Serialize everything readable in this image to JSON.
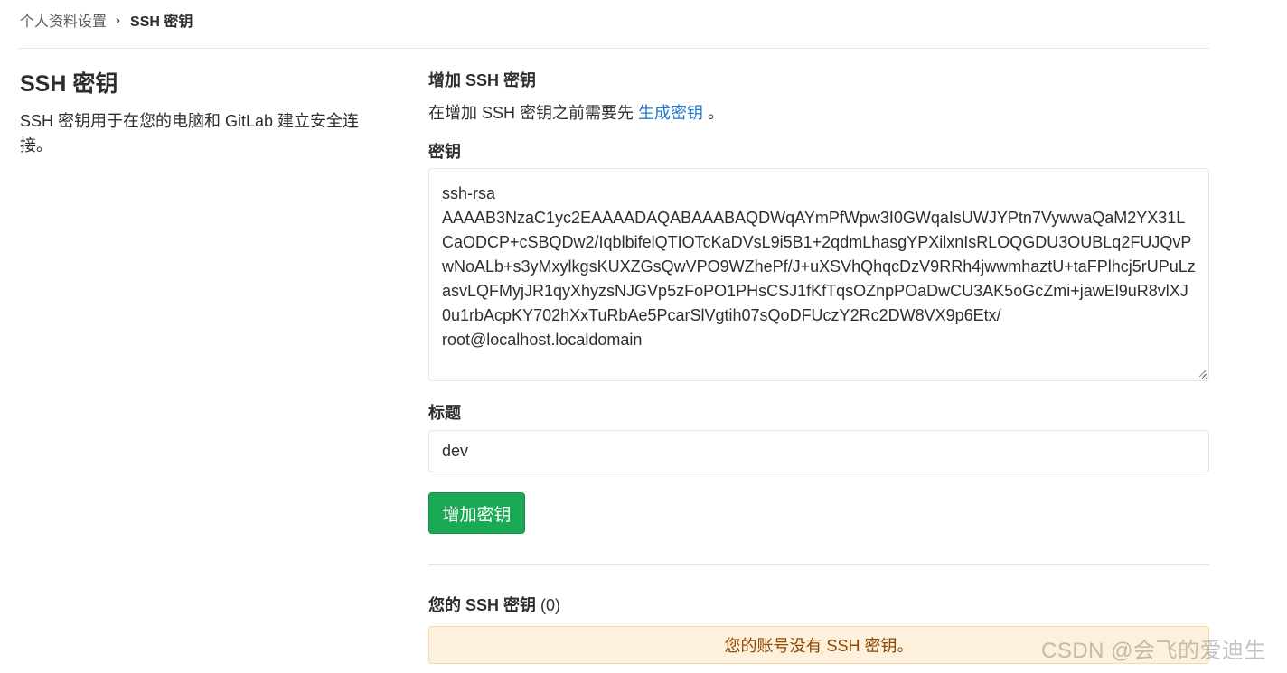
{
  "breadcrumb": {
    "parent": "个人资料设置",
    "separator": "›",
    "current": "SSH 密钥"
  },
  "left": {
    "title": "SSH 密钥",
    "description": "SSH 密钥用于在您的电脑和 GitLab 建立安全连接。"
  },
  "add_section": {
    "title": "增加 SSH 密钥",
    "intro_prefix": "在增加 SSH 密钥之前需要先 ",
    "intro_link": "生成密钥",
    "intro_suffix": " 。",
    "key_label": "密钥",
    "key_value": "ssh-rsa\nAAAAB3NzaC1yc2EAAAADAQABAAABAQDWqAYmPfWpw3I0GWqaIsUWJYPtn7VywwaQaM2YX31LCaODCP+cSBQDw2/IqblbifelQTIOTcKaDVsL9i5B1+2qdmLhasgYPXilxnIsRLOQGDU3OUBLq2FUJQvPwNoALb+s3yMxylkgsKUXZGsQwVPO9WZhePf/J+uXSVhQhqcDzV9RRh4jwwmhaztU+taFPlhcj5rUPuLzasvLQFMyjJR1qyXhyzsNJGVp5zFoPO1PHsCSJ1fKfTqsOZnpPOaDwCU3AK5oGcZmi+jawEl9uR8vlXJ0u1rbAcpKY702hXxTuRbAe5PcarSlVgtih07sQoDFUczY2Rc2DW8VX9p6Etx/\nroot@localhost.localdomain",
    "title_label": "标题",
    "title_value": "dev",
    "submit_label": "增加密钥"
  },
  "keys_list": {
    "heading": "您的 SSH 密钥",
    "count": "(0)",
    "empty_message": "您的账号没有 SSH 密钥。"
  },
  "watermark": "CSDN @会飞的爱迪生",
  "colors": {
    "primary_button": "#1aaa55",
    "link": "#1f78d1",
    "warning_bg": "#fdf1dd",
    "warning_text": "#8f4700"
  },
  "icons": {
    "breadcrumb_separator": "chevron-right-icon",
    "resize_grip": "resize-grip-icon"
  }
}
